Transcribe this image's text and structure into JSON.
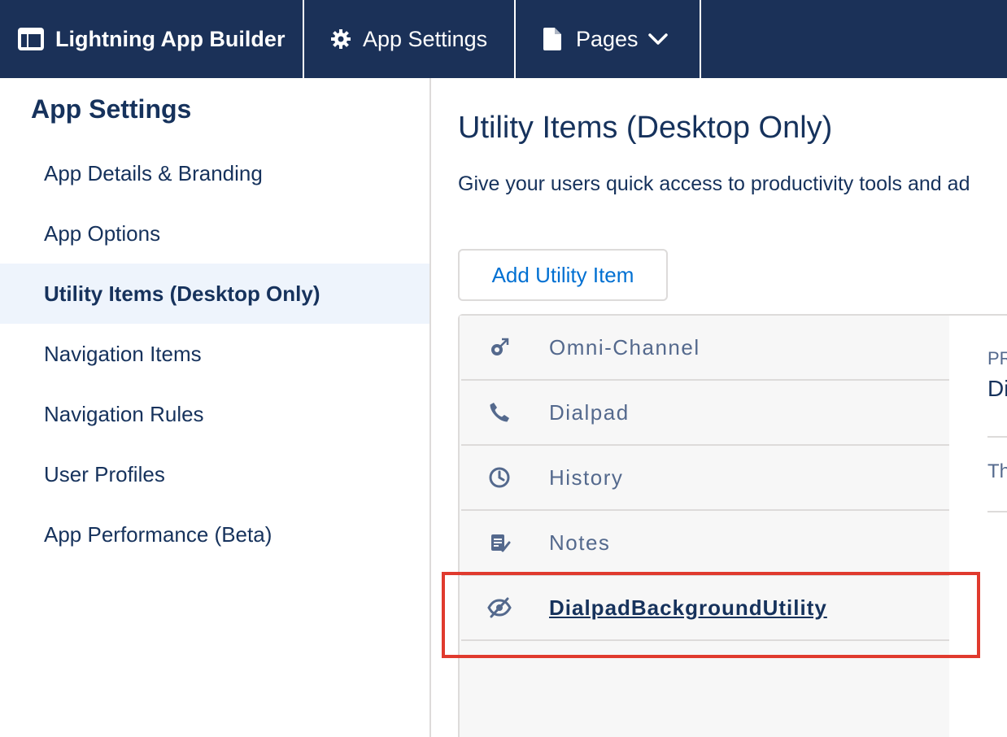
{
  "topbar": {
    "brand_label": "Lightning App Builder",
    "settings_label": "App Settings",
    "pages_label": "Pages"
  },
  "sidebar": {
    "title": "App Settings",
    "items": [
      {
        "label": "App Details & Branding",
        "active": false
      },
      {
        "label": "App Options",
        "active": false
      },
      {
        "label": "Utility Items (Desktop Only)",
        "active": true
      },
      {
        "label": "Navigation Items",
        "active": false
      },
      {
        "label": "Navigation Rules",
        "active": false
      },
      {
        "label": "User Profiles",
        "active": false
      },
      {
        "label": "App Performance (Beta)",
        "active": false
      }
    ]
  },
  "main": {
    "title": "Utility Items (Desktop Only)",
    "description": "Give your users quick access to productivity tools and ad",
    "add_button_label": "Add Utility Item",
    "utility_items": [
      {
        "label": "Omni-Channel",
        "icon": "omni-channel-icon"
      },
      {
        "label": "Dialpad",
        "icon": "phone-icon"
      },
      {
        "label": "History",
        "icon": "clock-icon"
      },
      {
        "label": "Notes",
        "icon": "notes-icon"
      },
      {
        "label": "DialpadBackgroundUtility",
        "icon": "hidden-eye-icon",
        "selected": true
      }
    ],
    "detail": {
      "label_partial": "PR",
      "value_partial": "Di",
      "text_partial": "Th"
    }
  },
  "colors": {
    "topbar_bg": "#1b3158",
    "text_primary": "#16325c",
    "link_blue": "#0070d2",
    "active_bg": "#eef4fc",
    "highlight_red": "#e03a2e"
  }
}
